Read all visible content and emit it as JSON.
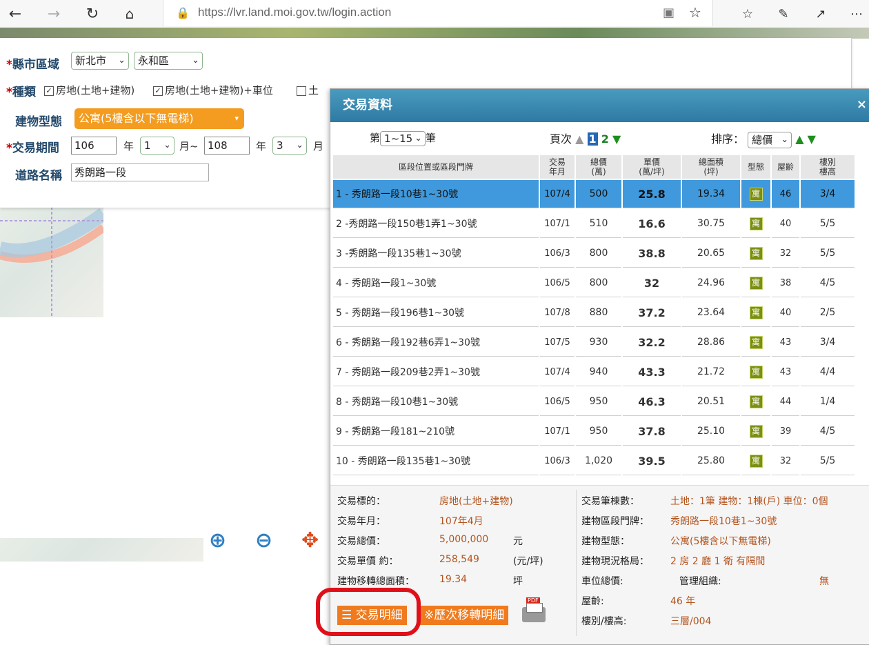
{
  "browser": {
    "url": "https://lvr.land.moi.gov.tw/login.action"
  },
  "form": {
    "county_label": "縣市區域",
    "county_value": "新北市",
    "district_value": "永和區",
    "type_label": "種類",
    "type_options": [
      "房地(土地+建物)",
      "房地(土地+建物)+車位",
      "土"
    ],
    "building_type_label": "建物型態",
    "building_type_value": "公寓(5樓含以下無電梯)",
    "period_label": "交易期間",
    "start_year": "106",
    "year_unit": "年",
    "start_month": "1",
    "month_to": "月~",
    "end_year": "108",
    "end_month": "3",
    "month_unit_cut": "月",
    "road_label": "道路名稱",
    "road_value": "秀朗路一段"
  },
  "dialog": {
    "title": "交易資料",
    "close": "×",
    "range_prefix": "第",
    "range_value": "1~15",
    "range_suffix": "筆",
    "page_label": "頁次",
    "page_current": "1",
    "page_next": "2",
    "sort_label": "排序：",
    "sort_value": "總價",
    "columns": [
      "區段位置或區段門牌",
      "交易\n年月",
      "總價\n(萬)",
      "單價\n(萬/坪)",
      "總面積\n(坪)",
      "型態",
      "屋齡",
      "樓別\n樓高"
    ],
    "type_glyph": "寓",
    "rows": [
      {
        "addr": "1  - 秀朗路一段10巷1~30號",
        "ym": "107/4",
        "total": "500",
        "unit": "25.8",
        "area": "19.34",
        "age": "46",
        "floor": "3/4"
      },
      {
        "addr": "2  -秀朗路一段150巷1弄1~30號",
        "ym": "107/1",
        "total": "510",
        "unit": "16.6",
        "area": "30.75",
        "age": "40",
        "floor": "5/5"
      },
      {
        "addr": "3  -秀朗路一段135巷1~30號",
        "ym": "106/3",
        "total": "800",
        "unit": "38.8",
        "area": "20.65",
        "age": "32",
        "floor": "5/5"
      },
      {
        "addr": "4  - 秀朗路一段1~30號",
        "ym": "106/5",
        "total": "800",
        "unit": "32",
        "area": "24.96",
        "age": "38",
        "floor": "4/5"
      },
      {
        "addr": "5  - 秀朗路一段196巷1~30號",
        "ym": "107/8",
        "total": "880",
        "unit": "37.2",
        "area": "23.64",
        "age": "40",
        "floor": "2/5"
      },
      {
        "addr": "6  - 秀朗路一段192巷6弄1~30號",
        "ym": "107/5",
        "total": "930",
        "unit": "32.2",
        "area": "28.86",
        "age": "43",
        "floor": "3/4"
      },
      {
        "addr": "7  - 秀朗路一段209巷2弄1~30號",
        "ym": "107/4",
        "total": "940",
        "unit": "43.3",
        "area": "21.72",
        "age": "43",
        "floor": "4/4"
      },
      {
        "addr": "8  - 秀朗路一段10巷1~30號",
        "ym": "106/5",
        "total": "950",
        "unit": "46.3",
        "area": "20.51",
        "age": "44",
        "floor": "1/4"
      },
      {
        "addr": "9  - 秀朗路一段181~210號",
        "ym": "107/1",
        "total": "950",
        "unit": "37.8",
        "area": "25.10",
        "age": "39",
        "floor": "4/5"
      },
      {
        "addr": "10  - 秀朗路一段135巷1~30號",
        "ym": "106/3",
        "total": "1,020",
        "unit": "39.5",
        "area": "25.80",
        "age": "32",
        "floor": "5/5"
      }
    ]
  },
  "detail": {
    "target_label": "交易標的：",
    "target_value": "房地(土地+建物)",
    "ym_label": "交易年月：",
    "ym_value": "107年4月",
    "total_label": "交易總價：",
    "total_value": "5,000,000",
    "total_unit": "元",
    "unit_label": "交易單價 約：",
    "unit_value": "258,549",
    "unit_unit": "(元/坪)",
    "area_label": "建物移轉總面積：",
    "area_value": "19.34",
    "area_unit": "坪",
    "count_label": "交易筆棟數：",
    "count_value": "土地：1筆 建物：1棟(戶) 車位：0個",
    "addr_label": "建物區段門牌：",
    "addr_value": "秀朗路一段10巷1~30號",
    "btype_label": "建物型態：",
    "btype_value": "公寓(5樓含以下無電梯)",
    "layout_label": "建物現況格局：",
    "layout_value": "2 房 2 廳 1 衛 有隔間",
    "parking_label": "車位總價:",
    "mgmt_label": "管理組織:",
    "mgmt_value": "無",
    "age_label": "屋齡:",
    "age_value": "46  年",
    "floor_label": "樓別/樓高:",
    "floor_value": "三層/004",
    "btn_detail": "交易明細",
    "btn_history": "※歷次移轉明細",
    "pdf_label": "PDF"
  },
  "colors": {
    "accent_orange": "#ef7b1e",
    "selected_row": "#3f99dc",
    "title_bar": "#2d7aa3",
    "highlight_circle": "#e0101a"
  }
}
